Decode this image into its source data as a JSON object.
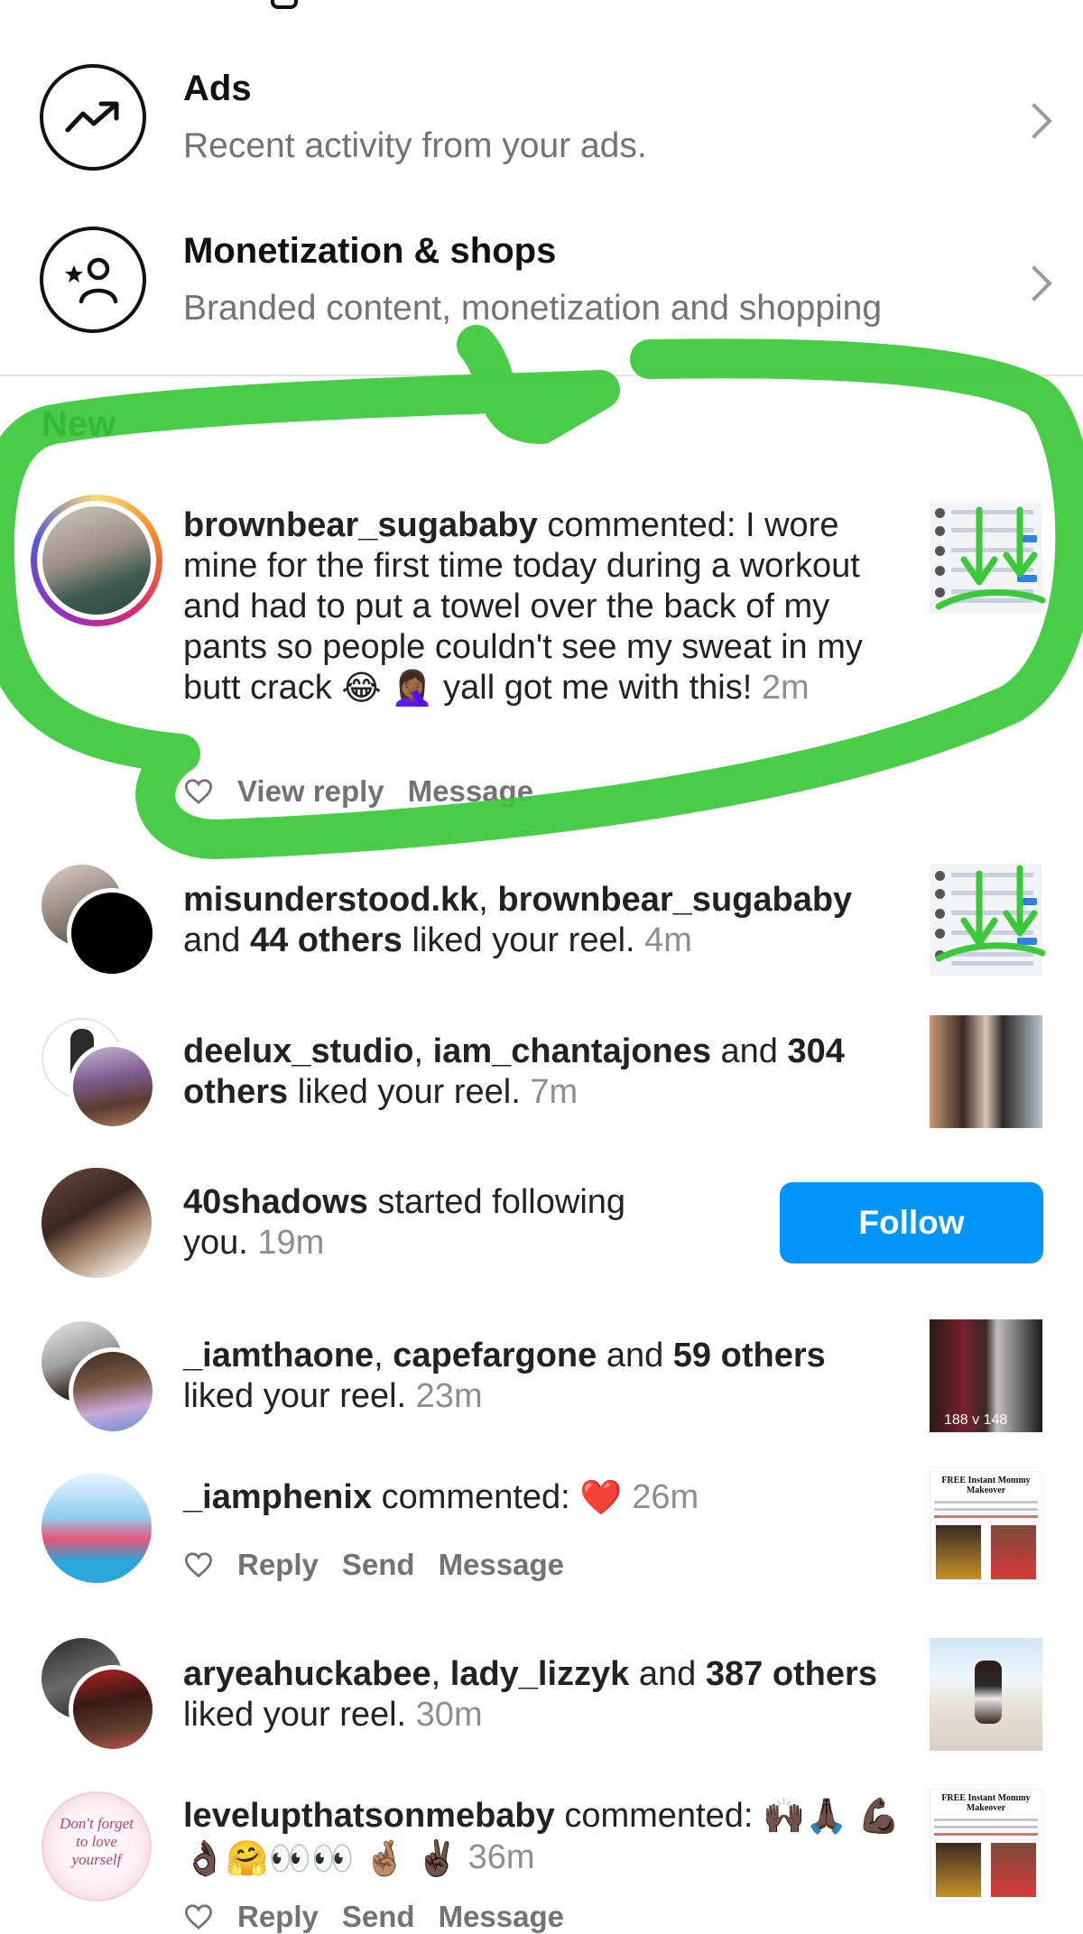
{
  "settings_rows": [
    {
      "title": "Ads",
      "subtitle": "Recent activity from your ads.",
      "icon": "trending-up-icon"
    },
    {
      "title": "Monetization & shops",
      "subtitle": "Branded content, monetization and shopping",
      "icon": "person-star-icon"
    }
  ],
  "section_new": "New",
  "notifications": [
    {
      "user": "brownbear_sugababy",
      "text_main": " commented: I wore mine for the first time today during a workout and had to put a towel over the back of my pants so people couldn't see my sweat in my butt crack ",
      "text_end": " yall got me with this! ",
      "emojis": [
        "😂",
        "🤦🏾‍♀️"
      ],
      "time": "2m",
      "actions": [
        "View reply",
        "Message"
      ]
    },
    {
      "user1": "misunderstood.kk",
      "sep1": ", ",
      "user2": "brownbear_sugababy",
      "mid": " and ",
      "count": "44 others",
      "tail": " liked your reel. ",
      "time": "4m"
    },
    {
      "user1": "deelux_studio",
      "sep1": ", ",
      "user2": "iam_chantajones",
      "mid": " and ",
      "count": "304 others",
      "tail": " liked your reel. ",
      "time": "7m"
    },
    {
      "user": "40shadows",
      "tail": " started following you. ",
      "time": "19m",
      "button": "Follow"
    },
    {
      "user1": "_iamthaone",
      "sep1": ", ",
      "user2": "capefargone",
      "mid": " and ",
      "count": "59 others",
      "tail": " liked your reel. ",
      "time": "23m",
      "thumb_caption": "188 v 148"
    },
    {
      "user": "_iamphenix",
      "tail": " commented: ",
      "emojis": [
        "❤️"
      ],
      "time": "26m",
      "actions": [
        "Reply",
        "Send",
        "Message"
      ],
      "thumb_caption": "FREE Instant Mommy Makeover"
    },
    {
      "user1": "aryeahuckabee",
      "sep1": ", ",
      "user2": "lady_lizzyk",
      "mid": " and ",
      "count": "387 others",
      "tail": " liked your reel. ",
      "time": "30m"
    },
    {
      "user": "levelupthatsonmebaby",
      "tail": " commented: ",
      "emojis": [
        "🙌🏿",
        "🙏🏿",
        "💪🏿",
        "👌🏿",
        "🤗",
        "👀",
        "👀",
        "🤞🏽",
        "✌🏿"
      ],
      "time": "36m",
      "actions": [
        "Reply",
        "Send",
        "Message"
      ],
      "avatar_caption": "Don't forget to love yourself",
      "thumb_caption": "FREE Instant Mommy Makeover"
    }
  ],
  "colors": {
    "follow": "#0095f6",
    "highlight": "#3ac93a",
    "secondary_text": "#737373"
  }
}
